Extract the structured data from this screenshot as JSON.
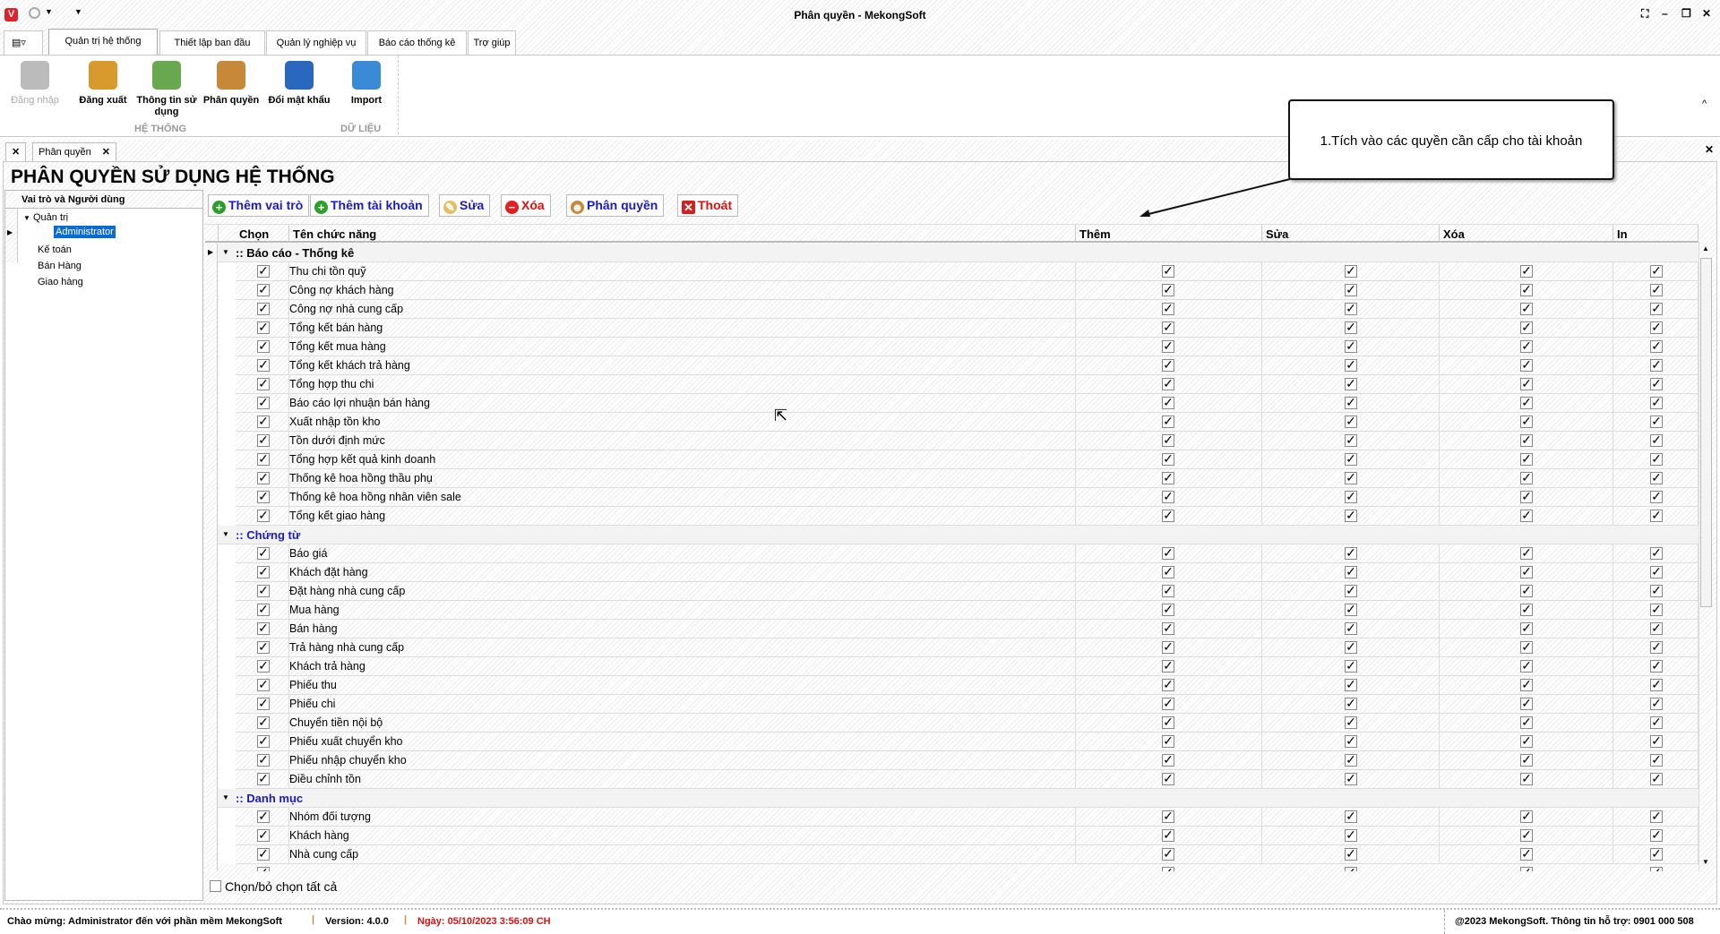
{
  "window": {
    "title": "Phân quyền - MekongSoft",
    "logo": "V"
  },
  "ribbon_tabs": [
    "Quản trị hệ thống",
    "Thiết lập ban đầu",
    "Quản lý nghiệp vụ",
    "Báo cáo thống kê",
    "Trợ giúp"
  ],
  "ribbon": {
    "buttons": [
      {
        "label": "Đăng nhập",
        "icon": "lock-icon",
        "color": "#bbbbbb",
        "disabled": true
      },
      {
        "label": "Đăng xuất",
        "icon": "logout-lock-icon",
        "color": "#d89a2c"
      },
      {
        "label": "Thông tin sử dụng",
        "icon": "user-info-icon",
        "color": "#6aa84f"
      },
      {
        "label": "Phân quyền",
        "icon": "users-key-icon",
        "color": "#c8883a"
      },
      {
        "label": "Đổi mật khẩu",
        "icon": "change-password-icon",
        "color": "#2a68c0"
      },
      {
        "label": "Import",
        "icon": "database-icon",
        "color": "#3a8ad8"
      }
    ],
    "groups": [
      "HỆ THỐNG",
      "DỮ LIỆU"
    ]
  },
  "doc_tab": "Phân quyền",
  "page_title": "PHÂN QUYỀN SỬ DỤNG HỆ THỐNG",
  "left_panel": {
    "header": "Vai trò và Người dùng",
    "nodes": [
      {
        "label": "Quản trị",
        "children": [
          "Administrator"
        ]
      },
      {
        "label": "Kế toán"
      },
      {
        "label": "Bán Hàng"
      },
      {
        "label": "Giao hàng"
      }
    ]
  },
  "toolbar": [
    {
      "label": "Thêm vai trò",
      "icon": "plus-icon",
      "color": "#1a1acc"
    },
    {
      "label": "Thêm tài khoản",
      "icon": "plus-icon",
      "color": "#1a1acc"
    },
    {
      "label": "Sửa",
      "icon": "pencil-icon",
      "color": "#1a1acc"
    },
    {
      "label": "Xóa",
      "icon": "minus-icon",
      "color": "#e01010"
    },
    {
      "label": "Phân quyền",
      "icon": "users-icon",
      "color": "#1a1acc"
    },
    {
      "label": "Thoát",
      "icon": "exit-icon",
      "color": "#e01010"
    }
  ],
  "grid": {
    "columns": [
      "Chọn",
      "Tên chức năng",
      "Thêm",
      "Sửa",
      "Xóa",
      "In"
    ],
    "groups": [
      {
        "label": ":: Báo cáo - Thống kê",
        "color": "#000000",
        "rows": [
          "Thu chi tồn quỹ",
          "Công nợ khách hàng",
          "Công nợ nhà cung cấp",
          "Tổng kết bán hàng",
          "Tổng kết mua hàng",
          "Tổng kết khách trả hàng",
          "Tổng hợp thu chi",
          "Báo cáo lợi nhuận bán hàng",
          "Xuất nhập tồn kho",
          "Tồn dưới định mức",
          "Tổng hợp kết quả kinh doanh",
          "Thống kê hoa hồng thầu phụ",
          "Thống kê hoa hồng nhân viên sale",
          "Tổng kết giao hàng"
        ]
      },
      {
        "label": ":: Chứng từ",
        "color": "#1a1acc",
        "rows": [
          "Báo giá",
          "Khách đặt hàng",
          "Đặt hàng nhà cung cấp",
          "Mua hàng",
          "Bán hàng",
          "Trả hàng nhà cung cấp",
          "Khách trả hàng",
          "Phiếu thu",
          "Phiếu chi",
          "Chuyển tiền nội bộ",
          "Phiếu xuất chuyển kho",
          "Phiếu nhập chuyển kho",
          "Điều chỉnh tồn"
        ]
      },
      {
        "label": ":: Danh mục",
        "color": "#1a1acc",
        "rows": [
          "Nhóm đối tượng",
          "Khách hàng",
          "Nhà cung cấp"
        ]
      }
    ],
    "all_checked": true
  },
  "select_all_label": "Chọn/bỏ chọn tất cả",
  "callout": "1.Tích vào các quyền cần cấp cho tài khoản",
  "status": {
    "welcome": "Chào mừng: Administrator đến với phần mềm MekongSoft",
    "version": "Version: 4.0.0",
    "date": "Ngày: 05/10/2023 3:56:09 CH",
    "copyright": "@2023 MekongSoft. Thông tin hỗ trợ: 0901 000 508"
  }
}
